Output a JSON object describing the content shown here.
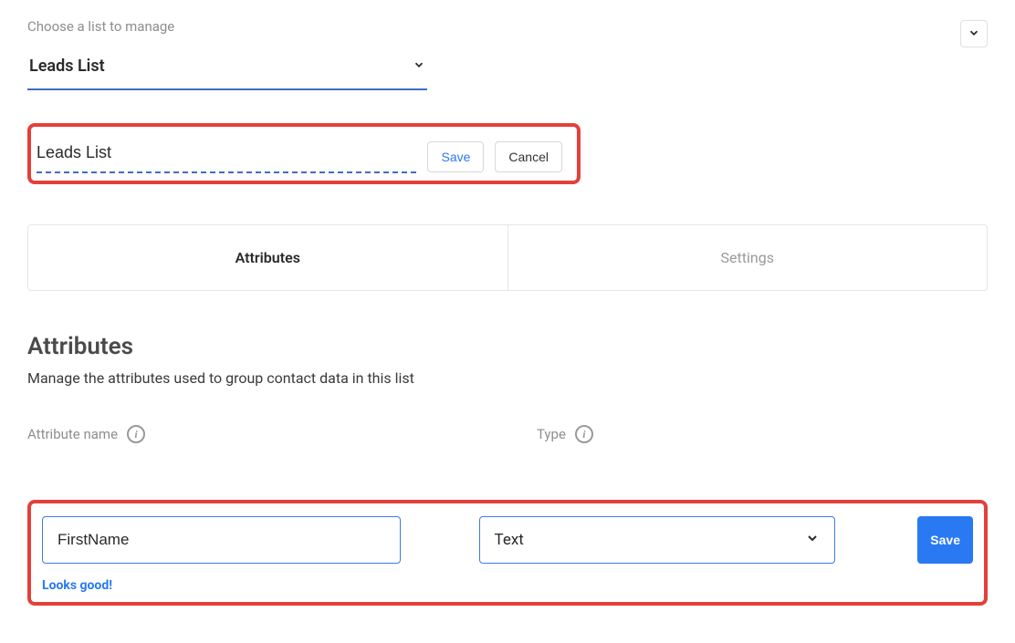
{
  "header": {
    "choose_label": "Choose a list to manage",
    "selected_list": "Leads List"
  },
  "rename": {
    "value": "Leads List",
    "save_label": "Save",
    "cancel_label": "Cancel"
  },
  "tabs": {
    "attributes": "Attributes",
    "settings": "Settings"
  },
  "attributes_section": {
    "title": "Attributes",
    "subtitle": "Manage the attributes used to group contact data in this list",
    "col_name": "Attribute name",
    "col_type": "Type"
  },
  "attribute_row": {
    "name_value": "FirstName",
    "type_value": "Text",
    "save_label": "Save",
    "validation": "Looks good!"
  }
}
